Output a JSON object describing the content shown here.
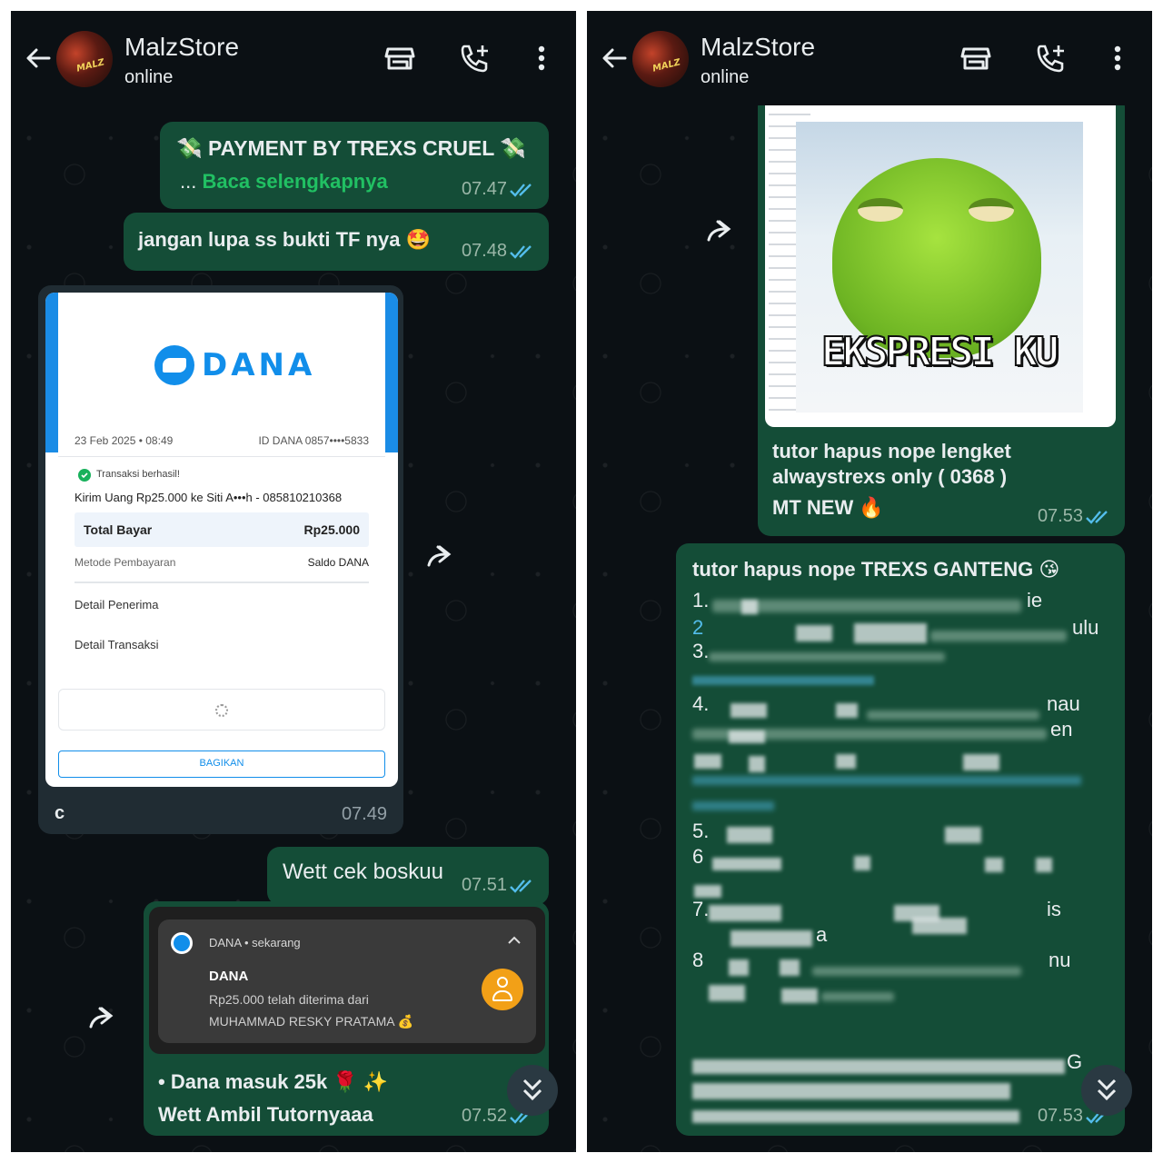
{
  "left": {
    "header": {
      "title": "MalzStore",
      "status": "online"
    },
    "msg_payment": {
      "title": "PAYMENT BY TREXS CRUEL",
      "read_more_prefix": "...",
      "read_more": "Baca selengkapnya",
      "time": "07.47"
    },
    "msg_reminder": {
      "text": "jangan lupa ss bukti TF nya 🤩",
      "time": "07.48"
    },
    "receipt": {
      "brand": "DANA",
      "date": "23 Feb 2025 • 08:49",
      "id_label": "ID DANA 0857••••5833",
      "status": "Transaksi berhasil!",
      "transfer": "Kirim Uang Rp25.000 ke Siti A•••h - 085810210368",
      "total_label": "Total Bayar",
      "total_value": "Rp25.000",
      "method_label": "Metode Pembayaran",
      "method_value": "Saldo DANA",
      "recipient_detail": "Detail Penerima",
      "transaction_detail": "Detail Transaksi",
      "share_button": "BAGIKAN",
      "caption": "c",
      "time": "07.49"
    },
    "msg_check": {
      "text": "Wett cek boskuu",
      "time": "07.51"
    },
    "notification": {
      "app": "DANA • sekarang",
      "title": "DANA",
      "line1": "Rp25.000 telah diterima dari",
      "line2": "MUHAMMAD RESKY PRATAMA 💰"
    },
    "msg_received": {
      "line1": "• Dana masuk 25k 🌹 ✨",
      "line2": "Wett Ambil Tutornyaaa",
      "time": "07.52"
    }
  },
  "right": {
    "header": {
      "title": "MalzStore",
      "status": "online"
    },
    "meme": {
      "caption_text": "EKSPRESI KU"
    },
    "msg_tutor1": {
      "line1": "tutor hapus nope lengket",
      "line2": "alwaystrexs only ( 0368 )",
      "line3": "MT NEW 🔥",
      "time": "07.53"
    },
    "msg_tutor2": {
      "title": "tutor hapus nope TREXS GANTENG 😘",
      "items": [
        "1.",
        "2",
        "3.",
        "4.",
        "5.",
        "6",
        "7.",
        "8"
      ],
      "fragments": {
        "f1": "ie",
        "f2": "ulu",
        "f3": "nau",
        "f4": "en",
        "f5": "is",
        "f6": "a",
        "f7": "nu",
        "f8": "G"
      },
      "time": "07.53"
    }
  },
  "colors": {
    "outgoing": "#144d37",
    "incoming": "#202c33",
    "link": "#53bdeb",
    "ticks": "#53bdeb",
    "dana_blue": "#118eea"
  }
}
